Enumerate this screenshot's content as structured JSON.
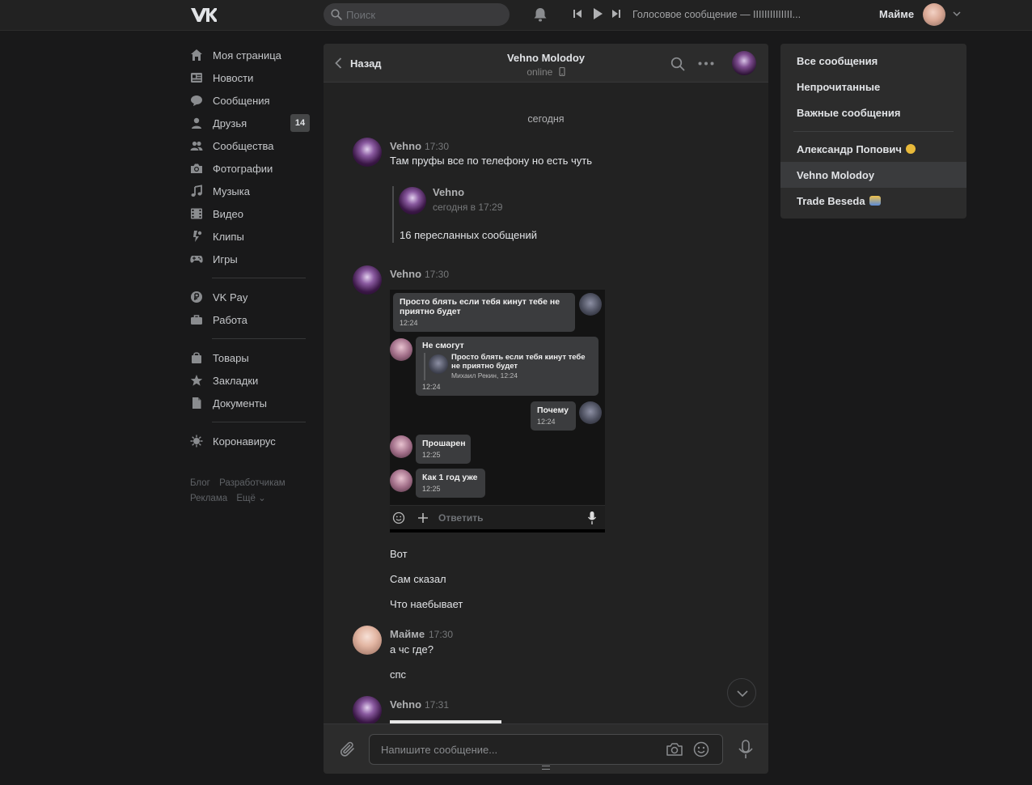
{
  "header": {
    "search_placeholder": "Поиск",
    "track_title": "Голосовое сообщение — IIIIIIIIIIIIII...",
    "user_name": "Майме"
  },
  "leftnav": {
    "items": [
      {
        "label": "Моя страница",
        "icon": "home-icon"
      },
      {
        "label": "Новости",
        "icon": "news-icon"
      },
      {
        "label": "Сообщения",
        "icon": "messages-icon"
      },
      {
        "label": "Друзья",
        "icon": "friends-icon",
        "badge": "14"
      },
      {
        "label": "Сообщества",
        "icon": "communities-icon"
      },
      {
        "label": "Фотографии",
        "icon": "camera-icon"
      },
      {
        "label": "Музыка",
        "icon": "music-icon"
      },
      {
        "label": "Видео",
        "icon": "video-icon"
      },
      {
        "label": "Клипы",
        "icon": "clips-icon"
      },
      {
        "label": "Игры",
        "icon": "gamepad-icon"
      }
    ],
    "items2": [
      {
        "label": "VK Pay",
        "icon": "vkpay-icon"
      },
      {
        "label": "Работа",
        "icon": "briefcase-icon"
      }
    ],
    "items3": [
      {
        "label": "Товары",
        "icon": "bag-icon"
      },
      {
        "label": "Закладки",
        "icon": "star-icon"
      },
      {
        "label": "Документы",
        "icon": "document-icon"
      }
    ],
    "items4": [
      {
        "label": "Коронавирус",
        "icon": "virus-icon"
      }
    ],
    "footer": {
      "blog": "Блог",
      "developers": "Разработчикам",
      "ads": "Реклама",
      "more": "Ещё ⌄"
    }
  },
  "chat": {
    "back_label": "Назад",
    "peer_name": "Vehno Molodoy",
    "peer_status": "online",
    "date_separator": "сегодня",
    "messages": [
      {
        "author": "Vehno",
        "time": "17:30",
        "text": "Там пруфы все по телефону но есть чуть"
      },
      {
        "author": "Vehno",
        "time": "17:30",
        "lines": [
          "Вот",
          "Сам сказал",
          "Что наебывает"
        ]
      },
      {
        "author": "Майме",
        "time": "17:30",
        "lines": [
          "а чс где?",
          "спс"
        ]
      },
      {
        "author": "Vehno",
        "time": "17:31"
      }
    ],
    "forward": {
      "author": "Vehno",
      "time": "сегодня в 17:29",
      "summary": "16 пересланных сообщений"
    },
    "screenshot": {
      "b1_text": "Просто блять если тебя кинут тебе не приятно будет",
      "b1_time": "12:24",
      "b2_text": "Не смогут",
      "b2_quote_text": "Просто блять если тебя кинут тебе не приятно будет",
      "b2_quote_meta": "Михаил Рекин, 12:24",
      "b2_time": "12:24",
      "b3_text": "Почему",
      "b3_time": "12:24",
      "b4_text": "Прошарен",
      "b4_time": "12:25",
      "b5_text": "Как 1 год уже",
      "b5_time": "12:25",
      "input_placeholder": "Ответить"
    },
    "composer_placeholder": "Напишите сообщение..."
  },
  "rightpanel": {
    "filters": [
      "Все сообщения",
      "Непрочитанные",
      "Важные сообщения"
    ],
    "chats": [
      {
        "name": "Александр Попович",
        "emoji": "sunglasses-emoji"
      },
      {
        "name": "Vehno Molodoy",
        "active": true
      },
      {
        "name": "Trade Beseda",
        "emoji": "people-emoji"
      }
    ]
  },
  "colors": {
    "background": "#19191a",
    "panel": "#2c2c2c",
    "chat_bg": "#222222",
    "text": "#e1e3e6",
    "muted": "#76787a",
    "active_row": "#3a3b3d"
  }
}
